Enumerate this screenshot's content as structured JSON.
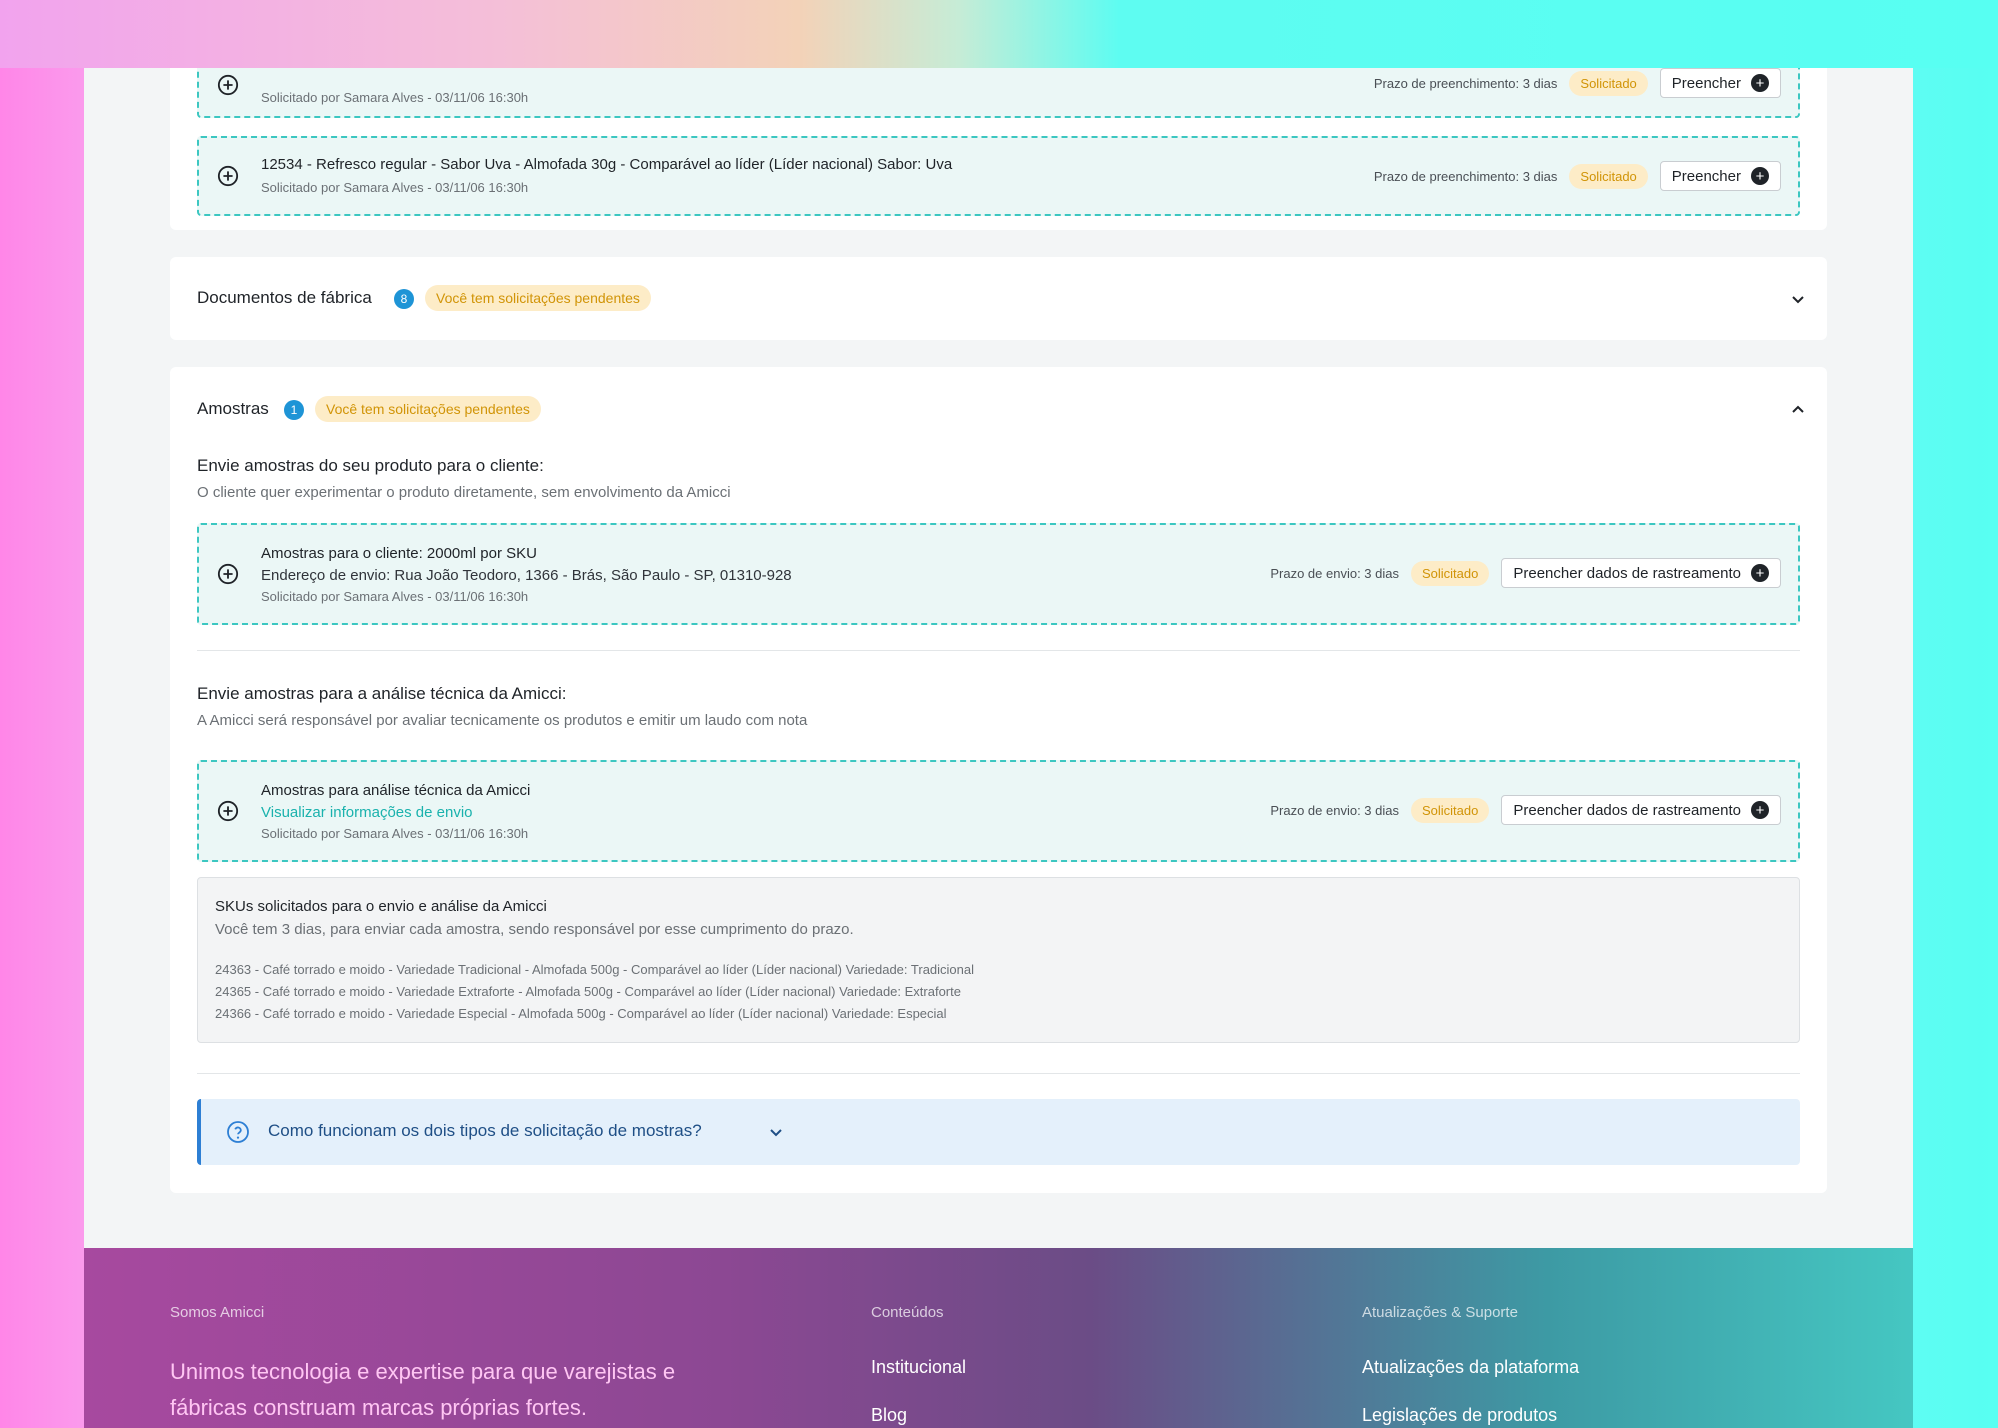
{
  "top_items": [
    {
      "title": "",
      "requested_by": "Solicitado por Samara Alves  - 03/11/06 16:30h",
      "deadline": "Prazo de preenchimento: 3 dias",
      "status": "Solicitado",
      "button": "Preencher"
    },
    {
      "title": "12534 - Refresco regular - Sabor Uva - Almofada 30g - Comparável ao líder (Líder nacional) Sabor: Uva",
      "requested_by": "Solicitado por Samara Alves  - 03/11/06 16:30h",
      "deadline": "Prazo de preenchimento: 3 dias",
      "status": "Solicitado",
      "button": "Preencher"
    }
  ],
  "documentos": {
    "title": "Documentos de fábrica",
    "count": "8",
    "pending": "Você tem solicitações pendentes"
  },
  "amostras": {
    "title": "Amostras",
    "count": "1",
    "pending": "Você tem solicitações pendentes",
    "cliente_heading": "Envie amostras do seu produto para o cliente:",
    "cliente_desc": "O cliente quer experimentar o produto diretamente, sem envolvimento da Amicci",
    "cliente_item": {
      "title": "Amostras para o cliente: 2000ml por SKU",
      "address": "Endereço de envio: Rua João Teodoro, 1366 - Brás, São Paulo - SP, 01310-928",
      "requested_by": "Solicitado por Samara Alves  - 03/11/06 16:30h",
      "deadline": "Prazo de envio: 3 dias",
      "status": "Solicitado",
      "button": "Preencher dados de rastreamento"
    },
    "tecnica_heading": "Envie amostras para a análise técnica da Amicci:",
    "tecnica_desc": "A Amicci será responsável por avaliar tecnicamente os produtos e emitir um laudo com nota",
    "tecnica_item": {
      "title": "Amostras para análise técnica da Amicci",
      "link": "Visualizar informações de envio",
      "requested_by": "Solicitado por Samara Alves  - 03/11/06 16:30h",
      "deadline": "Prazo de envio: 3 dias",
      "status": "Solicitado",
      "button": "Preencher dados de rastreamento"
    },
    "skus": {
      "title": "SKUs solicitados para o envio e análise da Amicci",
      "desc": "Você tem 3 dias, para enviar cada amostra, sendo responsável por esse cumprimento do prazo.",
      "items": [
        "24363 - Café torrado e moido - Variedade Tradicional - Almofada 500g - Comparável ao líder (Líder nacional) Variedade: Tradicional",
        "24365 - Café torrado e moido - Variedade Extraforte - Almofada 500g - Comparável ao líder (Líder nacional) Variedade: Extraforte",
        "24366 - Café torrado e moido - Variedade Especial - Almofada 500g - Comparável ao líder (Líder nacional) Variedade: Especial"
      ]
    },
    "faq": "Como funcionam os dois tipos de solicitação de mostras?"
  },
  "footer": {
    "col1_head": "Somos Amicci",
    "tagline": "Unimos tecnologia e expertise para que varejistas e fábricas construam marcas próprias fortes.",
    "col2_head": "Conteúdos",
    "col2_links": [
      "Institucional",
      "Blog"
    ],
    "col3_head": "Atualizações & Suporte",
    "col3_links": [
      "Atualizações da plataforma",
      "Legislações de produtos"
    ]
  },
  "colors": {
    "accent_teal": "#3cc7c1",
    "badge_bg": "#fdecc7",
    "badge_text": "#d19407",
    "count_blue": "#1e94d6",
    "info_blue": "#2d7fd4"
  }
}
